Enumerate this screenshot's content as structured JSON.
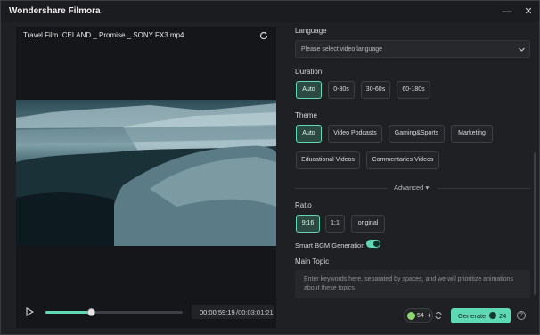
{
  "window": {
    "title": "Wondershare Filmora"
  },
  "preview": {
    "file_name": "Travel Film ICELAND _ Promise _ SONY FX3.mp4",
    "current_time": "00:00:59:19",
    "total_time": "/00:03:01:21",
    "progress": 0.34
  },
  "language": {
    "label": "Language",
    "placeholder": "Please select video language"
  },
  "duration": {
    "label": "Duration",
    "options": [
      "Auto",
      "0-30s",
      "30-60s",
      "60-180s"
    ],
    "selected": "Auto"
  },
  "theme": {
    "label": "Theme",
    "options": [
      "Auto",
      "Video Podcasts",
      "Gaming&Sports",
      "Marketing",
      "Educational Videos",
      "Commentaries Videos"
    ],
    "selected": "Auto"
  },
  "advanced": {
    "label": "Advanced"
  },
  "ratio": {
    "label": "Ratio",
    "options": [
      "9:16",
      "1:1",
      "original"
    ],
    "selected": "9:16"
  },
  "smart_bgm": {
    "label": "Smart BGM Generation",
    "enabled": true
  },
  "main_topic": {
    "label": "Main Topic",
    "placeholder": "Enter keywords here, separated by spaces, and we will prioritize animations about these topics"
  },
  "footer": {
    "credits": "54",
    "add": "+",
    "generate_label": "Generate",
    "generate_cost": "24",
    "help": "?"
  },
  "colors": {
    "accent": "#5fd9b4",
    "panel": "#1f2024"
  }
}
